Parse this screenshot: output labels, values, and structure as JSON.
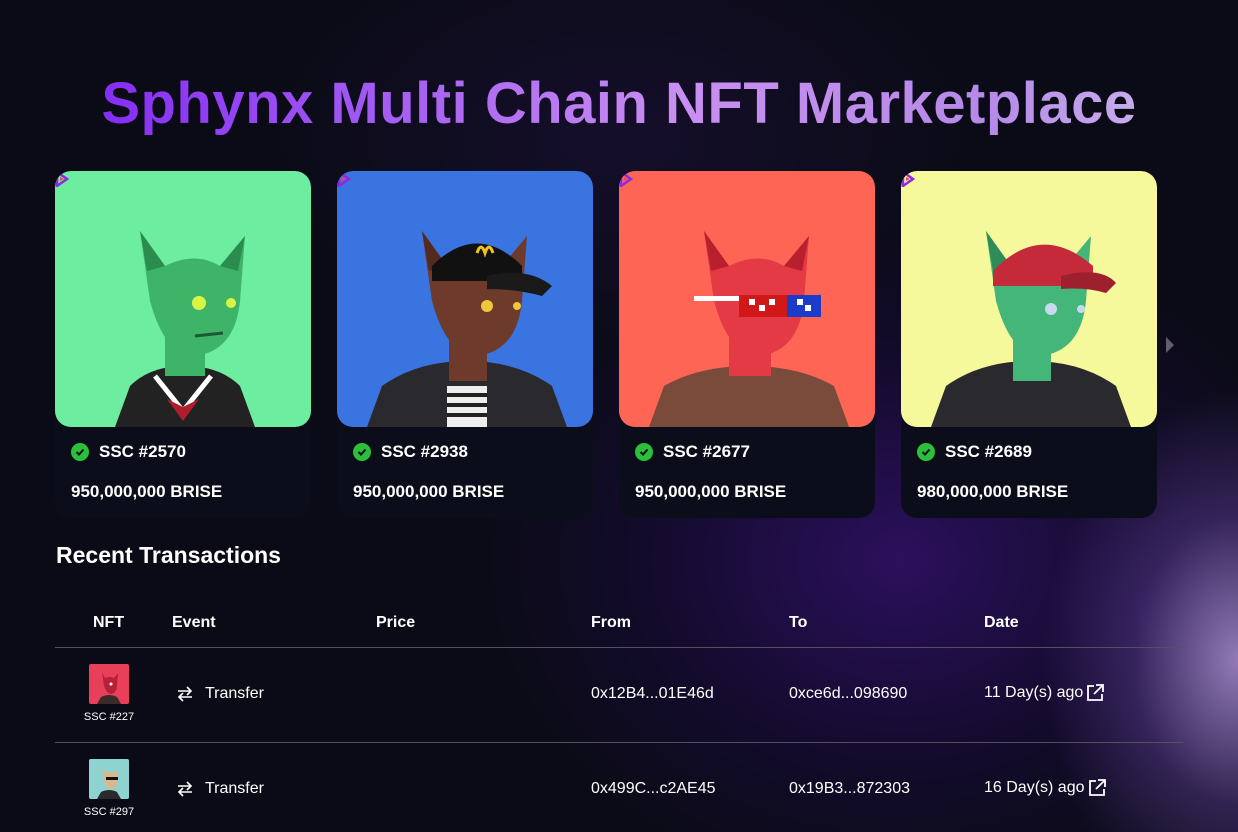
{
  "page_title": "Sphynx Multi Chain NFT Marketplace",
  "carousel": {
    "cards": [
      {
        "name": "SSC #2570",
        "price": "950,000,000 BRISE",
        "bg_color": "#6ded9f",
        "skin": "#3db468",
        "accessory": "sailor-collar"
      },
      {
        "name": "SSC #2938",
        "price": "950,000,000 BRISE",
        "bg_color": "#3a74e0",
        "skin": "#6d3a2c",
        "accessory": "black-cap"
      },
      {
        "name": "SSC #2677",
        "price": "950,000,000 BRISE",
        "bg_color": "#ff6555",
        "skin": "#e33a46",
        "accessory": "pixel-sunglasses"
      },
      {
        "name": "SSC #2689",
        "price": "980,000,000 BRISE",
        "bg_color": "#f6f89c",
        "skin": "#45b67a",
        "accessory": "red-cap"
      }
    ]
  },
  "transactions": {
    "title": "Recent Transactions",
    "columns": [
      "NFT",
      "Event",
      "Price",
      "From",
      "To",
      "Date"
    ],
    "rows": [
      {
        "nft": "SSC #227",
        "event": "Transfer",
        "price": "",
        "from": "0x12B4...01E46d",
        "to": "0xce6d...098690",
        "date": "11 Day(s) ago",
        "thumb_bg": "#e8405a"
      },
      {
        "nft": "SSC #297",
        "event": "Transfer",
        "price": "",
        "from": "0x499C...c2AE45",
        "to": "0x19B3...872303",
        "date": "16 Day(s) ago",
        "thumb_bg": "#8fd3d1"
      }
    ]
  }
}
